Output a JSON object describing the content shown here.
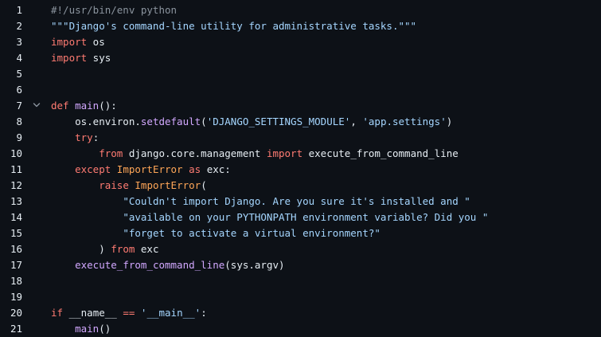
{
  "editor": {
    "lines": [
      {
        "number": "1",
        "fold": false,
        "tokens": [
          [
            "comment",
            "#!/usr/bin/env python"
          ]
        ]
      },
      {
        "number": "2",
        "fold": false,
        "tokens": [
          [
            "string",
            "\"\"\"Django's command-line utility for administrative tasks.\"\"\""
          ]
        ]
      },
      {
        "number": "3",
        "fold": false,
        "tokens": [
          [
            "keyword",
            "import"
          ],
          [
            "plain",
            " os"
          ]
        ]
      },
      {
        "number": "4",
        "fold": false,
        "tokens": [
          [
            "keyword",
            "import"
          ],
          [
            "plain",
            " sys"
          ]
        ]
      },
      {
        "number": "5",
        "fold": false,
        "tokens": []
      },
      {
        "number": "6",
        "fold": false,
        "tokens": []
      },
      {
        "number": "7",
        "fold": true,
        "tokens": [
          [
            "keyword",
            "def"
          ],
          [
            "plain",
            " "
          ],
          [
            "func",
            "main"
          ],
          [
            "plain",
            "():"
          ]
        ]
      },
      {
        "number": "8",
        "fold": false,
        "tokens": [
          [
            "plain",
            "    os.environ."
          ],
          [
            "func",
            "setdefault"
          ],
          [
            "plain",
            "("
          ],
          [
            "string",
            "'DJANGO_SETTINGS_MODULE'"
          ],
          [
            "plain",
            ", "
          ],
          [
            "string",
            "'app.settings'"
          ],
          [
            "plain",
            ")"
          ]
        ]
      },
      {
        "number": "9",
        "fold": false,
        "tokens": [
          [
            "plain",
            "    "
          ],
          [
            "keyword",
            "try"
          ],
          [
            "plain",
            ":"
          ]
        ]
      },
      {
        "number": "10",
        "fold": false,
        "tokens": [
          [
            "plain",
            "        "
          ],
          [
            "keyword",
            "from"
          ],
          [
            "plain",
            " django.core.management "
          ],
          [
            "keyword",
            "import"
          ],
          [
            "plain",
            " execute_from_command_line"
          ]
        ]
      },
      {
        "number": "11",
        "fold": false,
        "tokens": [
          [
            "plain",
            "    "
          ],
          [
            "keyword",
            "except"
          ],
          [
            "plain",
            " "
          ],
          [
            "class",
            "ImportError"
          ],
          [
            "plain",
            " "
          ],
          [
            "keyword",
            "as"
          ],
          [
            "plain",
            " exc:"
          ]
        ]
      },
      {
        "number": "12",
        "fold": false,
        "tokens": [
          [
            "plain",
            "        "
          ],
          [
            "keyword",
            "raise"
          ],
          [
            "plain",
            " "
          ],
          [
            "class",
            "ImportError"
          ],
          [
            "plain",
            "("
          ]
        ]
      },
      {
        "number": "13",
        "fold": false,
        "tokens": [
          [
            "plain",
            "            "
          ],
          [
            "string",
            "\"Couldn't import Django. Are you sure it's installed and \""
          ]
        ]
      },
      {
        "number": "14",
        "fold": false,
        "tokens": [
          [
            "plain",
            "            "
          ],
          [
            "string",
            "\"available on your PYTHONPATH environment variable? Did you \""
          ]
        ]
      },
      {
        "number": "15",
        "fold": false,
        "tokens": [
          [
            "plain",
            "            "
          ],
          [
            "string",
            "\"forget to activate a virtual environment?\""
          ]
        ]
      },
      {
        "number": "16",
        "fold": false,
        "tokens": [
          [
            "plain",
            "        ) "
          ],
          [
            "keyword",
            "from"
          ],
          [
            "plain",
            " exc"
          ]
        ]
      },
      {
        "number": "17",
        "fold": false,
        "tokens": [
          [
            "plain",
            "    "
          ],
          [
            "func",
            "execute_from_command_line"
          ],
          [
            "plain",
            "(sys.argv)"
          ]
        ]
      },
      {
        "number": "18",
        "fold": false,
        "tokens": []
      },
      {
        "number": "19",
        "fold": false,
        "tokens": []
      },
      {
        "number": "20",
        "fold": false,
        "tokens": [
          [
            "keyword",
            "if"
          ],
          [
            "plain",
            " __name__ "
          ],
          [
            "keyword",
            "=="
          ],
          [
            "plain",
            " "
          ],
          [
            "string",
            "'__main__'"
          ],
          [
            "plain",
            ":"
          ]
        ]
      },
      {
        "number": "21",
        "fold": false,
        "tokens": [
          [
            "plain",
            "    "
          ],
          [
            "func",
            "main"
          ],
          [
            "plain",
            "()"
          ]
        ]
      }
    ],
    "fold_icon": "chevron-down-icon"
  },
  "colors": {
    "background": "#0d1117",
    "text": "#e6edf3",
    "comment": "#8b949e",
    "string": "#a5d6ff",
    "keyword": "#ff7b72",
    "function": "#d2a8ff",
    "class": "#ffa657"
  }
}
